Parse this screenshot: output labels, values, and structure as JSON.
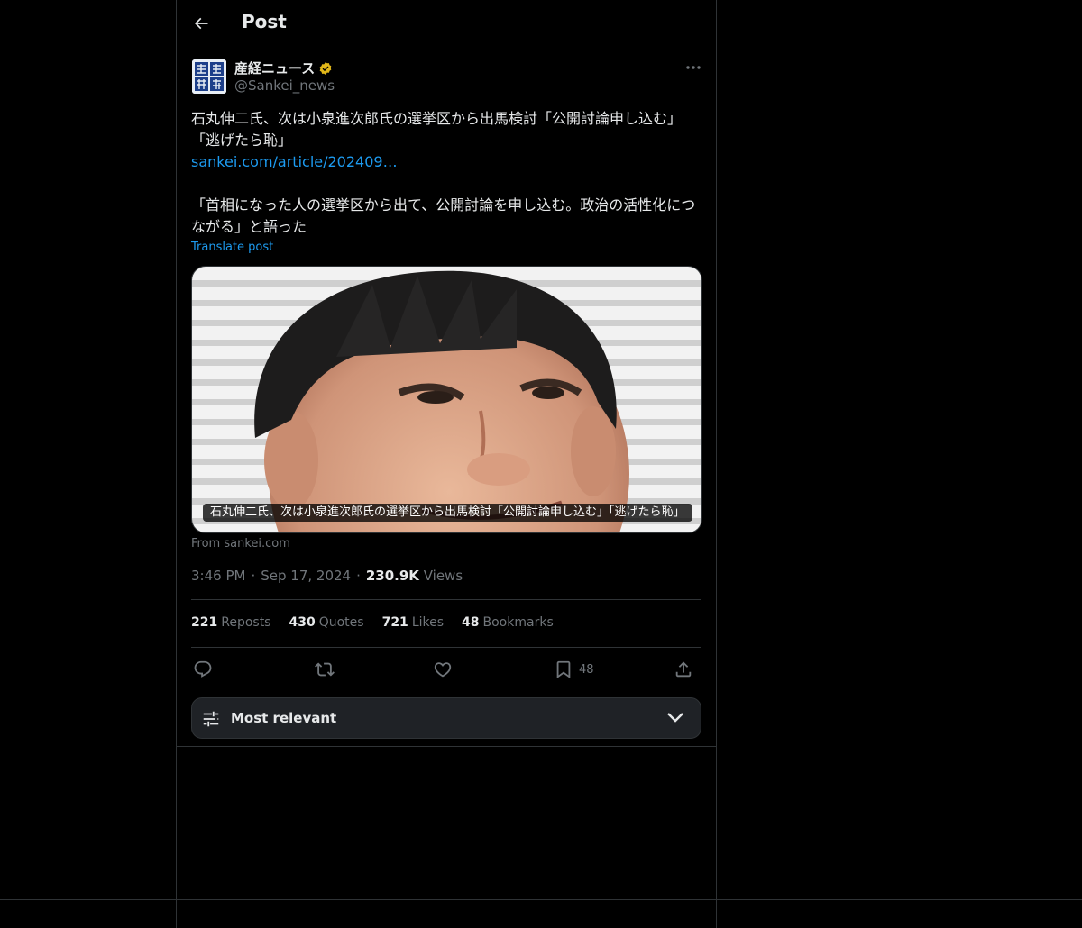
{
  "header": {
    "title": "Post"
  },
  "author": {
    "name": "産経ニュース",
    "handle": "@Sankei_news"
  },
  "post": {
    "line1": "石丸伸二氏、次は小泉進次郎氏の選挙区から出馬検討「公開討論申し込む」「逃げたら恥」",
    "link": "sankei.com/article/202409…",
    "line2": "「首相になった人の選挙区から出て、公開討論を申し込む。政治の活性化につながる」と語った",
    "translate": "Translate post"
  },
  "card": {
    "caption": "石丸伸二氏、次は小泉進次郎氏の選挙区から出馬検討「公開討論申し込む」「逃げたら恥」",
    "source": "From sankei.com"
  },
  "meta": {
    "time": "3:46 PM",
    "date": "Sep 17, 2024",
    "views_count": "230.9K",
    "views_label": "Views",
    "sep": "·"
  },
  "stats": {
    "reposts_count": "221",
    "reposts_label": "Reposts",
    "quotes_count": "430",
    "quotes_label": "Quotes",
    "likes_count": "721",
    "likes_label": "Likes",
    "bookmarks_count": "48",
    "bookmarks_label": "Bookmarks"
  },
  "actions": {
    "bookmark_count": "48"
  },
  "sort": {
    "label": "Most relevant"
  },
  "colors": {
    "background": "#000000",
    "accent": "#1d9bf0",
    "muted": "#71767b",
    "text": "#e7e9ea",
    "verified": "#e2b719"
  },
  "icons": [
    "back-arrow-icon",
    "verified-badge-icon",
    "more-icon",
    "reply-icon",
    "repost-icon",
    "like-icon",
    "bookmark-icon",
    "share-icon",
    "sliders-icon",
    "chevron-down-icon"
  ]
}
